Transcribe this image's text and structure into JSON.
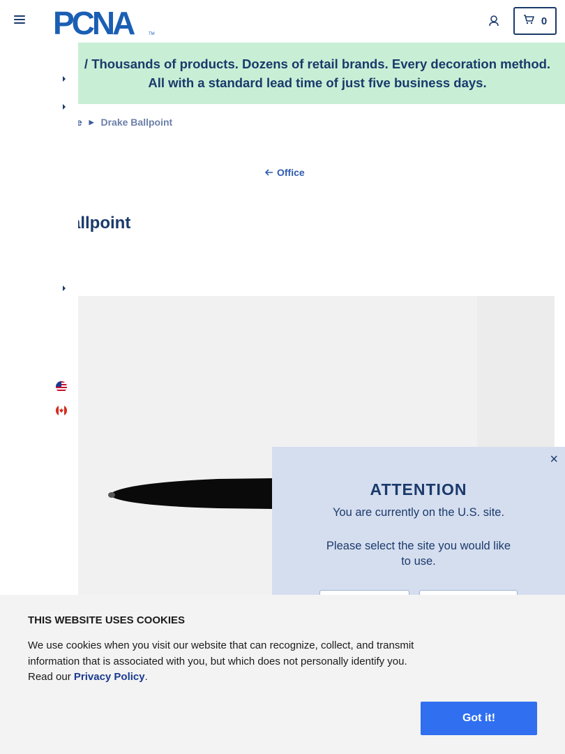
{
  "header": {
    "logo_text": "PCNA",
    "logo_tm": "TM",
    "cart_count": "0"
  },
  "promo": {
    "text": "/ Thousands of products. Dozens of retail brands. Every decoration method. All with a standard lead time of just five business days."
  },
  "breadcrumb": {
    "parent": "ce",
    "current": "Drake Ballpoint"
  },
  "back_link": {
    "label": "Office"
  },
  "product": {
    "title_visible": "allpoint"
  },
  "attention_modal": {
    "title": "ATTENTION",
    "message": "You are currently on the U.S. site.",
    "prompt": "Please select the site you would like to use.",
    "close": "×"
  },
  "cookie_banner": {
    "title": "THIS WEBSITE USES COOKIES",
    "text_before": "We use cookies when you visit our website that can recognize, collect, and transmit information that is associated with you, but which does not personally identify you. Read our ",
    "link": "Privacy Policy",
    "text_after": ".",
    "button": "Got it!"
  },
  "colors": {
    "brand_navy": "#1a3a6b",
    "logo_blue": "#1a5fb4",
    "promo_bg": "#c8efd5",
    "modal_bg": "#d5deef",
    "cookie_button": "#2f6ff0"
  },
  "icons": {
    "menu": "hamburger-icon",
    "account": "user-icon",
    "cart": "cart-icon",
    "back": "arrow-left-icon",
    "flags": [
      "us-flag-icon",
      "canada-flag-icon"
    ]
  }
}
